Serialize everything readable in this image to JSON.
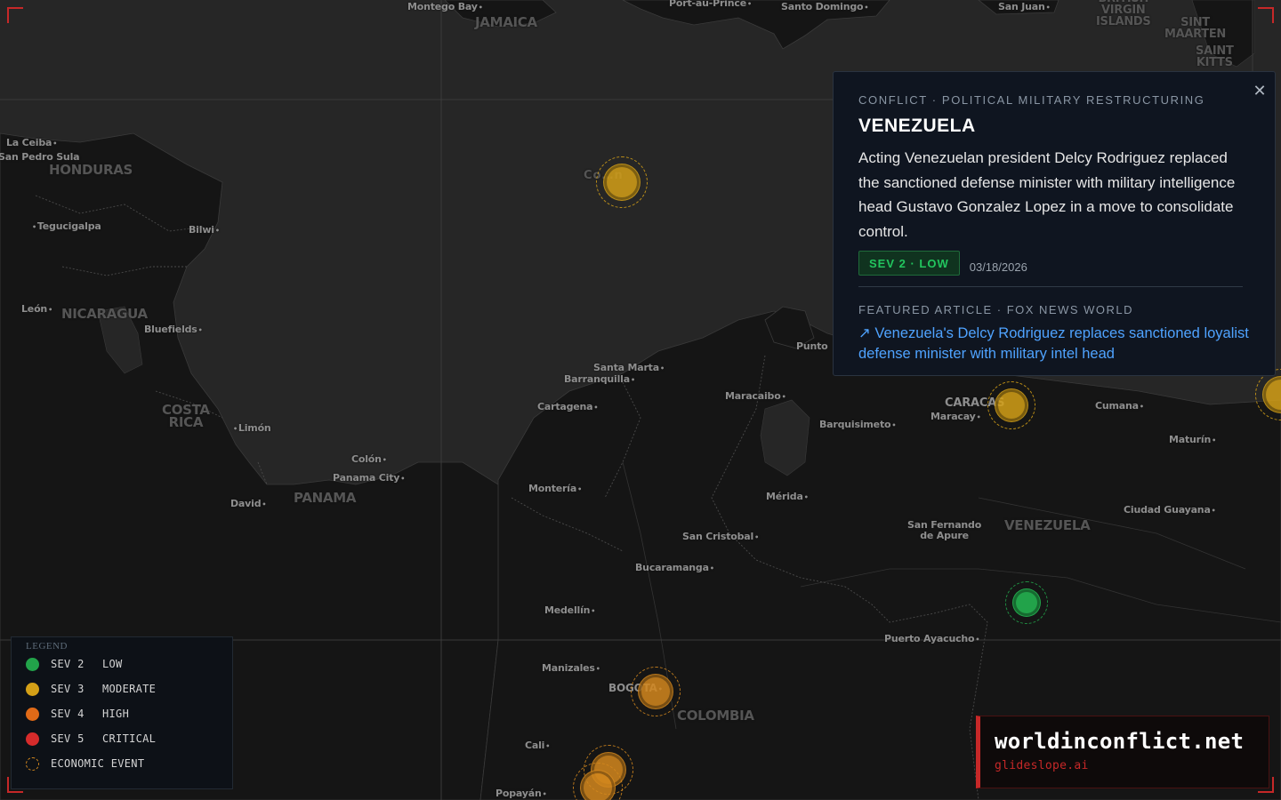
{
  "map": {
    "places": [
      {
        "id": "montego-bay",
        "name": "Montego Bay"
      },
      {
        "id": "port-au-prince",
        "name": "Port-au-Prince"
      },
      {
        "id": "santo-domingo",
        "name": "Santo Domingo"
      },
      {
        "id": "san-juan",
        "name": "San Juan"
      },
      {
        "id": "la-ceiba",
        "name": "La Ceiba"
      },
      {
        "id": "san-pedro-sula",
        "name": "San Pedro Sula"
      },
      {
        "id": "tegucigalpa",
        "name": "Tegucigalpa"
      },
      {
        "id": "bilwi",
        "name": "Bilwi"
      },
      {
        "id": "leon",
        "name": "León"
      },
      {
        "id": "bluefields",
        "name": "Bluefields"
      },
      {
        "id": "limon",
        "name": "Limón"
      },
      {
        "id": "colon",
        "name": "Colón"
      },
      {
        "id": "panama-city",
        "name": "Panama City"
      },
      {
        "id": "david",
        "name": "David"
      },
      {
        "id": "santa-marta",
        "name": "Santa Marta"
      },
      {
        "id": "barranquilla",
        "name": "Barranquilla"
      },
      {
        "id": "cartagena",
        "name": "Cartagena"
      },
      {
        "id": "punto",
        "name": "Punto"
      },
      {
        "id": "maracaibo",
        "name": "Maracaibo"
      },
      {
        "id": "barquisimeto",
        "name": "Barquisimeto"
      },
      {
        "id": "maracay",
        "name": "Maracay"
      },
      {
        "id": "cumana",
        "name": "Cumana"
      },
      {
        "id": "maturin",
        "name": "Maturín"
      },
      {
        "id": "monteria",
        "name": "Montería"
      },
      {
        "id": "merida",
        "name": "Mérida"
      },
      {
        "id": "san-cristobal",
        "name": "San Cristobal"
      },
      {
        "id": "san-fernando",
        "name": "San Fernando\nde Apure"
      },
      {
        "id": "ciudad-guayana",
        "name": "Ciudad Guayana"
      },
      {
        "id": "bucaramanga",
        "name": "Bucaramanga"
      },
      {
        "id": "medellin",
        "name": "Medellín"
      },
      {
        "id": "puerto-ayacucho",
        "name": "Puerto Ayacucho"
      },
      {
        "id": "manizales",
        "name": "Manizales"
      },
      {
        "id": "bogota",
        "name": "BOGOTA"
      },
      {
        "id": "cali",
        "name": "Cali"
      },
      {
        "id": "popayan",
        "name": "Popayán"
      },
      {
        "id": "caracas",
        "name": "CARACAS"
      },
      {
        "id": "cartagena-island",
        "name": "Co…n"
      }
    ],
    "countries": [
      {
        "id": "jamaica",
        "name": "JAMAICA"
      },
      {
        "id": "honduras",
        "name": "HONDURAS"
      },
      {
        "id": "nicaragua",
        "name": "NICARAGUA"
      },
      {
        "id": "costa-rica",
        "name": "COSTA\nRICA"
      },
      {
        "id": "panama",
        "name": "PANAMA"
      },
      {
        "id": "venezuela",
        "name": "VENEZUELA"
      },
      {
        "id": "colombia",
        "name": "COLOMBIA"
      },
      {
        "id": "bvi",
        "name": "BRITISH\nVIRGIN\nISLANDS"
      },
      {
        "id": "sint-maarten",
        "name": "SINT\nMAARTEN"
      },
      {
        "id": "saint-kitts",
        "name": "SAINT\nKITTS"
      }
    ]
  },
  "markers": [
    {
      "id": "caribbean-sea",
      "severity": 3,
      "color": "#d4a017"
    },
    {
      "id": "caracas",
      "severity": 3,
      "color": "#d4a017"
    },
    {
      "id": "venezuela-south",
      "severity": 2,
      "color": "#22a34a"
    },
    {
      "id": "bogota",
      "severity": 3,
      "color": "#d4881e"
    },
    {
      "id": "colombia-south-1",
      "severity": 3,
      "color": "#d4881e"
    },
    {
      "id": "colombia-south-2",
      "severity": 3,
      "color": "#d4881e"
    },
    {
      "id": "east-edge",
      "severity": 3,
      "color": "#d4a017"
    }
  ],
  "detail_card": {
    "kicker": "CONFLICT · POLITICAL MILITARY RESTRUCTURING",
    "title": "VENEZUELA",
    "description": "Acting Venezuelan president Delcy Rodriguez replaced the sanctioned defense minister with military intelligence head Gustavo Gonzalez Lopez in a move to consolidate control.",
    "severity_badge": "SEV 2 · LOW",
    "date": "03/18/2026",
    "featured_kicker": "FEATURED ARTICLE · FOX NEWS WORLD",
    "article_link": "↗ Venezuela's Delcy Rodriguez replaces sanctioned loyalist defense minister with military intel head",
    "close_icon": "close-icon",
    "colors": {
      "badge_text": "#22c55e",
      "link": "#4fa3ff"
    }
  },
  "legend": {
    "title": "LEGEND",
    "items": [
      {
        "sev": "SEV 2",
        "label": "LOW",
        "color": "#22a34a"
      },
      {
        "sev": "SEV 3",
        "label": "MODERATE",
        "color": "#d4a017"
      },
      {
        "sev": "SEV 4",
        "label": "HIGH",
        "color": "#e06a17"
      },
      {
        "sev": "SEV 5",
        "label": "CRITICAL",
        "color": "#d62b2b"
      },
      {
        "sev": "",
        "label": "ECONOMIC EVENT",
        "color": "#d4881e",
        "dashed": true
      }
    ]
  },
  "brand": {
    "name": "worldinconflict.net",
    "sub": "glideslope.ai",
    "accent": "#c62828"
  }
}
